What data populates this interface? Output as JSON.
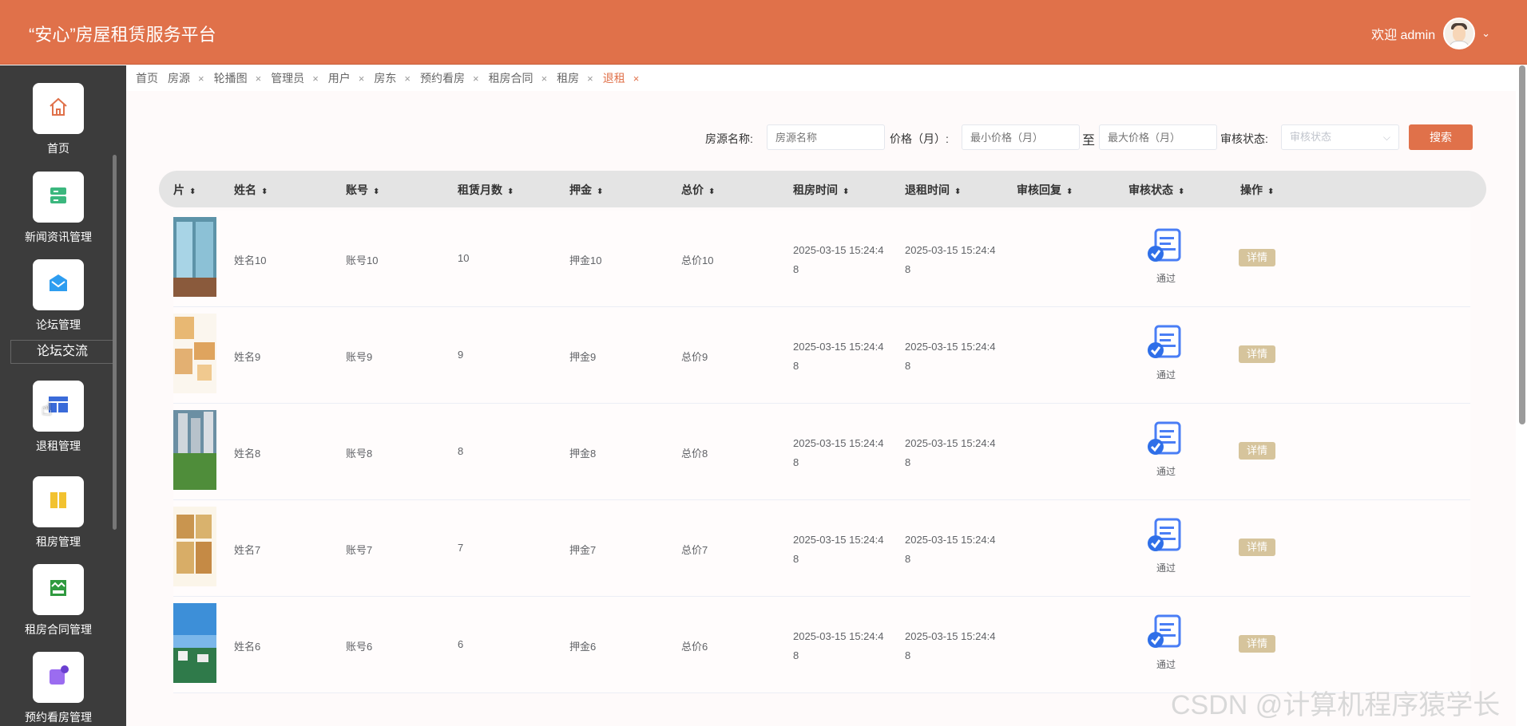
{
  "header": {
    "title": "“安心”房屋租赁服务平台",
    "welcome": "欢迎 admin",
    "caret": "⌄"
  },
  "sidebar": {
    "items": [
      {
        "label": "首页",
        "icon": "home-icon"
      },
      {
        "label": "新闻资讯管理",
        "icon": "news-icon"
      },
      {
        "label": "论坛管理",
        "icon": "forum-icon"
      },
      {
        "label": "论坛交流"
      },
      {
        "label": "退租管理",
        "icon": "checkout-icon"
      },
      {
        "label": "租房管理",
        "icon": "rent-icon"
      },
      {
        "label": "租房合同管理",
        "icon": "contract-icon"
      },
      {
        "label": "预约看房管理",
        "icon": "appointment-icon"
      }
    ]
  },
  "tabs": [
    {
      "label": "首页"
    },
    {
      "label": "房源",
      "close": "×"
    },
    {
      "label": "轮播图",
      "close": "×"
    },
    {
      "label": "管理员",
      "close": "×"
    },
    {
      "label": "用户",
      "close": "×"
    },
    {
      "label": "房东",
      "close": "×"
    },
    {
      "label": "预约看房",
      "close": "×"
    },
    {
      "label": "租房合同",
      "close": "×"
    },
    {
      "label": "租房",
      "close": "×"
    },
    {
      "label": "退租",
      "close": "×",
      "active": true
    }
  ],
  "search": {
    "name_label": "房源名称:",
    "name_placeholder": "房源名称",
    "price_label": "价格（月）:",
    "min_placeholder": "最小价格（月）",
    "to": "至",
    "max_placeholder": "最大价格（月）",
    "status_label": "审核状态:",
    "status_placeholder": "审核状态",
    "status_arrow": "⌵",
    "button": "搜索"
  },
  "table": {
    "columns": [
      "片",
      "姓名",
      "账号",
      "租赁月数",
      "押金",
      "总价",
      "租房时间",
      "退租时间",
      "审核回复",
      "审核状态",
      "操作"
    ],
    "sort_icon": "⬍",
    "rows": [
      {
        "name": "姓名10",
        "account": "账号10",
        "months": "10",
        "deposit": "押金10",
        "total": "总价10",
        "rent_time": "2025-03-15 15:24:48",
        "return_time": "2025-03-15 15:24:48",
        "status": "通过",
        "action": "详情"
      },
      {
        "name": "姓名9",
        "account": "账号9",
        "months": "9",
        "deposit": "押金9",
        "total": "总价9",
        "rent_time": "2025-03-15 15:24:48",
        "return_time": "2025-03-15 15:24:48",
        "status": "通过",
        "action": "详情"
      },
      {
        "name": "姓名8",
        "account": "账号8",
        "months": "8",
        "deposit": "押金8",
        "total": "总价8",
        "rent_time": "2025-03-15 15:24:48",
        "return_time": "2025-03-15 15:24:48",
        "status": "通过",
        "action": "详情"
      },
      {
        "name": "姓名7",
        "account": "账号7",
        "months": "7",
        "deposit": "押金7",
        "total": "总价7",
        "rent_time": "2025-03-15 15:24:48",
        "return_time": "2025-03-15 15:24:48",
        "status": "通过",
        "action": "详情"
      },
      {
        "name": "姓名6",
        "account": "账号6",
        "months": "6",
        "deposit": "押金6",
        "total": "总价6",
        "rent_time": "2025-03-15 15:24:48",
        "return_time": "2025-03-15 15:24:48",
        "status": "通过",
        "action": "详情"
      }
    ]
  },
  "watermark": "CSDN @计算机程序猿学长",
  "colors": {
    "header": "#e0714a",
    "sidebar": "#3c3c3c",
    "detail_button": "#d6c49c",
    "status_icon": "#4a7ef5"
  }
}
